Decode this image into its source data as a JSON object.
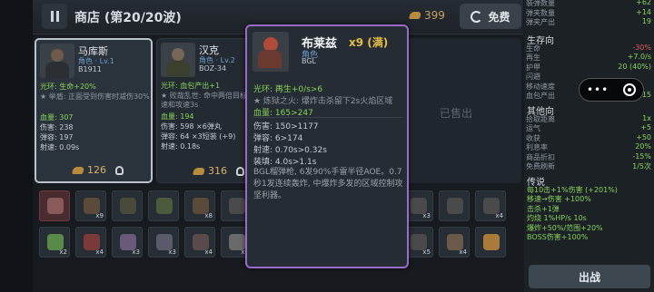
{
  "header": {
    "title": "商店 (第20/20波)",
    "gold": "399",
    "free_label": "免费"
  },
  "cards": [
    {
      "name": "马库斯",
      "role": "角色 · Lv.1",
      "code": "B1911",
      "lines": [
        "光环: 生命+20%",
        "★ 举盾: 正面受到伤害时减伤30%",
        "血量: 307",
        "伤害: 238",
        "弹容: 197",
        "射速: 0.09s"
      ],
      "price": "126"
    },
    {
      "name": "汉克",
      "role": "角色 · Lv.2",
      "code": "BOZ-34",
      "lines": [
        "光环: 血包产出+1",
        "★ 败哉乱世: 命中两倍目标伤害",
        "速和攻速3s",
        "血量: 194",
        "伤害: 598 ×6弹丸",
        "弹容: 64 ×3短装 (+9)",
        "射速: 0.18s"
      ],
      "price": "316"
    }
  ],
  "sold_label": "已售出",
  "tooltip": {
    "name": "布莱兹",
    "level": "x9 (满)",
    "role": "角色",
    "code": "BGL",
    "aura": "光环: 再生+0/s>6",
    "skill": "★ 炼狱之火: 爆炸击杀留下2s火焰区域",
    "hp": "血量: 165>247",
    "dmg": "伤害: 150>1177",
    "ammo": "弹容: 6>174",
    "rate": "射速: 0.70s>0.32s",
    "reload": "装填: 4.0s>1.1s",
    "desc": "BGL榴弹枪, 6发90%手雷半径AOE。0.7秒1发连续轰炸, 中爆炸多发的区域控制攻坚利器。"
  },
  "inventory": {
    "row1": [
      {
        "count": "",
        "color": "#8a5a5a"
      },
      {
        "count": "x9",
        "color": "#5a4a3a"
      },
      {
        "count": "",
        "color": "#4a4a3a"
      },
      {
        "count": "",
        "color": "#4a5a3a"
      },
      {
        "count": "x8",
        "color": "#5a4a3a"
      },
      {
        "count": "",
        "color": "#4a4a4a"
      },
      {
        "count": "",
        "color": "#4a4a4a"
      },
      {
        "count": "",
        "color": "#4a4a4a"
      },
      {
        "count": "",
        "color": "#4a4a4a"
      },
      {
        "count": "",
        "color": "#4a4a4a"
      },
      {
        "count": "x3",
        "color": "#4a4a4a"
      },
      {
        "count": "",
        "color": "#4a4a4a"
      },
      {
        "count": "x4",
        "color": "#4a4a4a"
      }
    ],
    "row2": [
      {
        "count": "x2",
        "color": "#5a8a4a"
      },
      {
        "count": "x4",
        "color": "#7a3a3a"
      },
      {
        "count": "x3",
        "color": "#6a5a7a"
      },
      {
        "count": "x3",
        "color": "#5a5a6a"
      },
      {
        "count": "x4",
        "color": "#5a4a4a"
      },
      {
        "count": "x4",
        "color": "#6a6a6a"
      },
      {
        "count": "x4",
        "color": "#4a4a4a"
      },
      {
        "count": "",
        "color": "#4a4a4a"
      },
      {
        "count": "",
        "color": "#4a4a4a"
      },
      {
        "count": "",
        "color": "#4a4a4a"
      },
      {
        "count": "x5",
        "color": "#4a4a4a"
      },
      {
        "count": "x4",
        "color": "#6a5a4a"
      },
      {
        "count": "",
        "color": "#aa7a3a"
      }
    ]
  },
  "right_panel": {
    "top": [
      {
        "label": "装弹数量",
        "value": "+62"
      },
      {
        "label": "弹夹数量",
        "value": "+14"
      },
      {
        "label": "弹夹产出",
        "value": "19"
      }
    ],
    "survival_title": "生存向",
    "survival": [
      {
        "label": "生命",
        "value": "-30%",
        "color": "#e05a5a"
      },
      {
        "label": "再生",
        "value": "+7.0/s",
        "color": "#86d35a"
      },
      {
        "label": "护甲",
        "value": "20 (40%)",
        "color": "#86d35a"
      },
      {
        "label": "闪避",
        "value": "",
        "color": "#86d35a"
      },
      {
        "label": "移动速度",
        "value": "",
        "color": "#86d35a"
      },
      {
        "label": "血包产出",
        "value": "15",
        "color": "#86d35a"
      }
    ],
    "other_title": "其他向",
    "other": [
      {
        "label": "拾取距离",
        "value": "1x",
        "color": "#86d35a"
      },
      {
        "label": "运气",
        "value": "+5",
        "color": "#86d35a"
      },
      {
        "label": "收获",
        "value": "+50",
        "color": "#86d35a"
      },
      {
        "label": "利息率",
        "value": "20%",
        "color": "#86d35a"
      },
      {
        "label": "商品折扣",
        "value": "-15%",
        "color": "#86d35a"
      },
      {
        "label": "免费刷新",
        "value": "1/5次",
        "color": "#86d35a"
      }
    ],
    "legend_title": "传说",
    "legend": [
      "每10击+1%伤害 (+201%)",
      "移速→伤害 +100%",
      "击杀+1弹",
      "灼烧 1%HP/s 10s",
      "爆炸+50%/范围+20%",
      "BOSS伤害+100%"
    ],
    "fight_label": "出战"
  },
  "colors": {
    "tooltip_border": "#9b6bcb",
    "gold": "#d8b06a",
    "positive": "#86d35a",
    "negative": "#e05a5a"
  }
}
